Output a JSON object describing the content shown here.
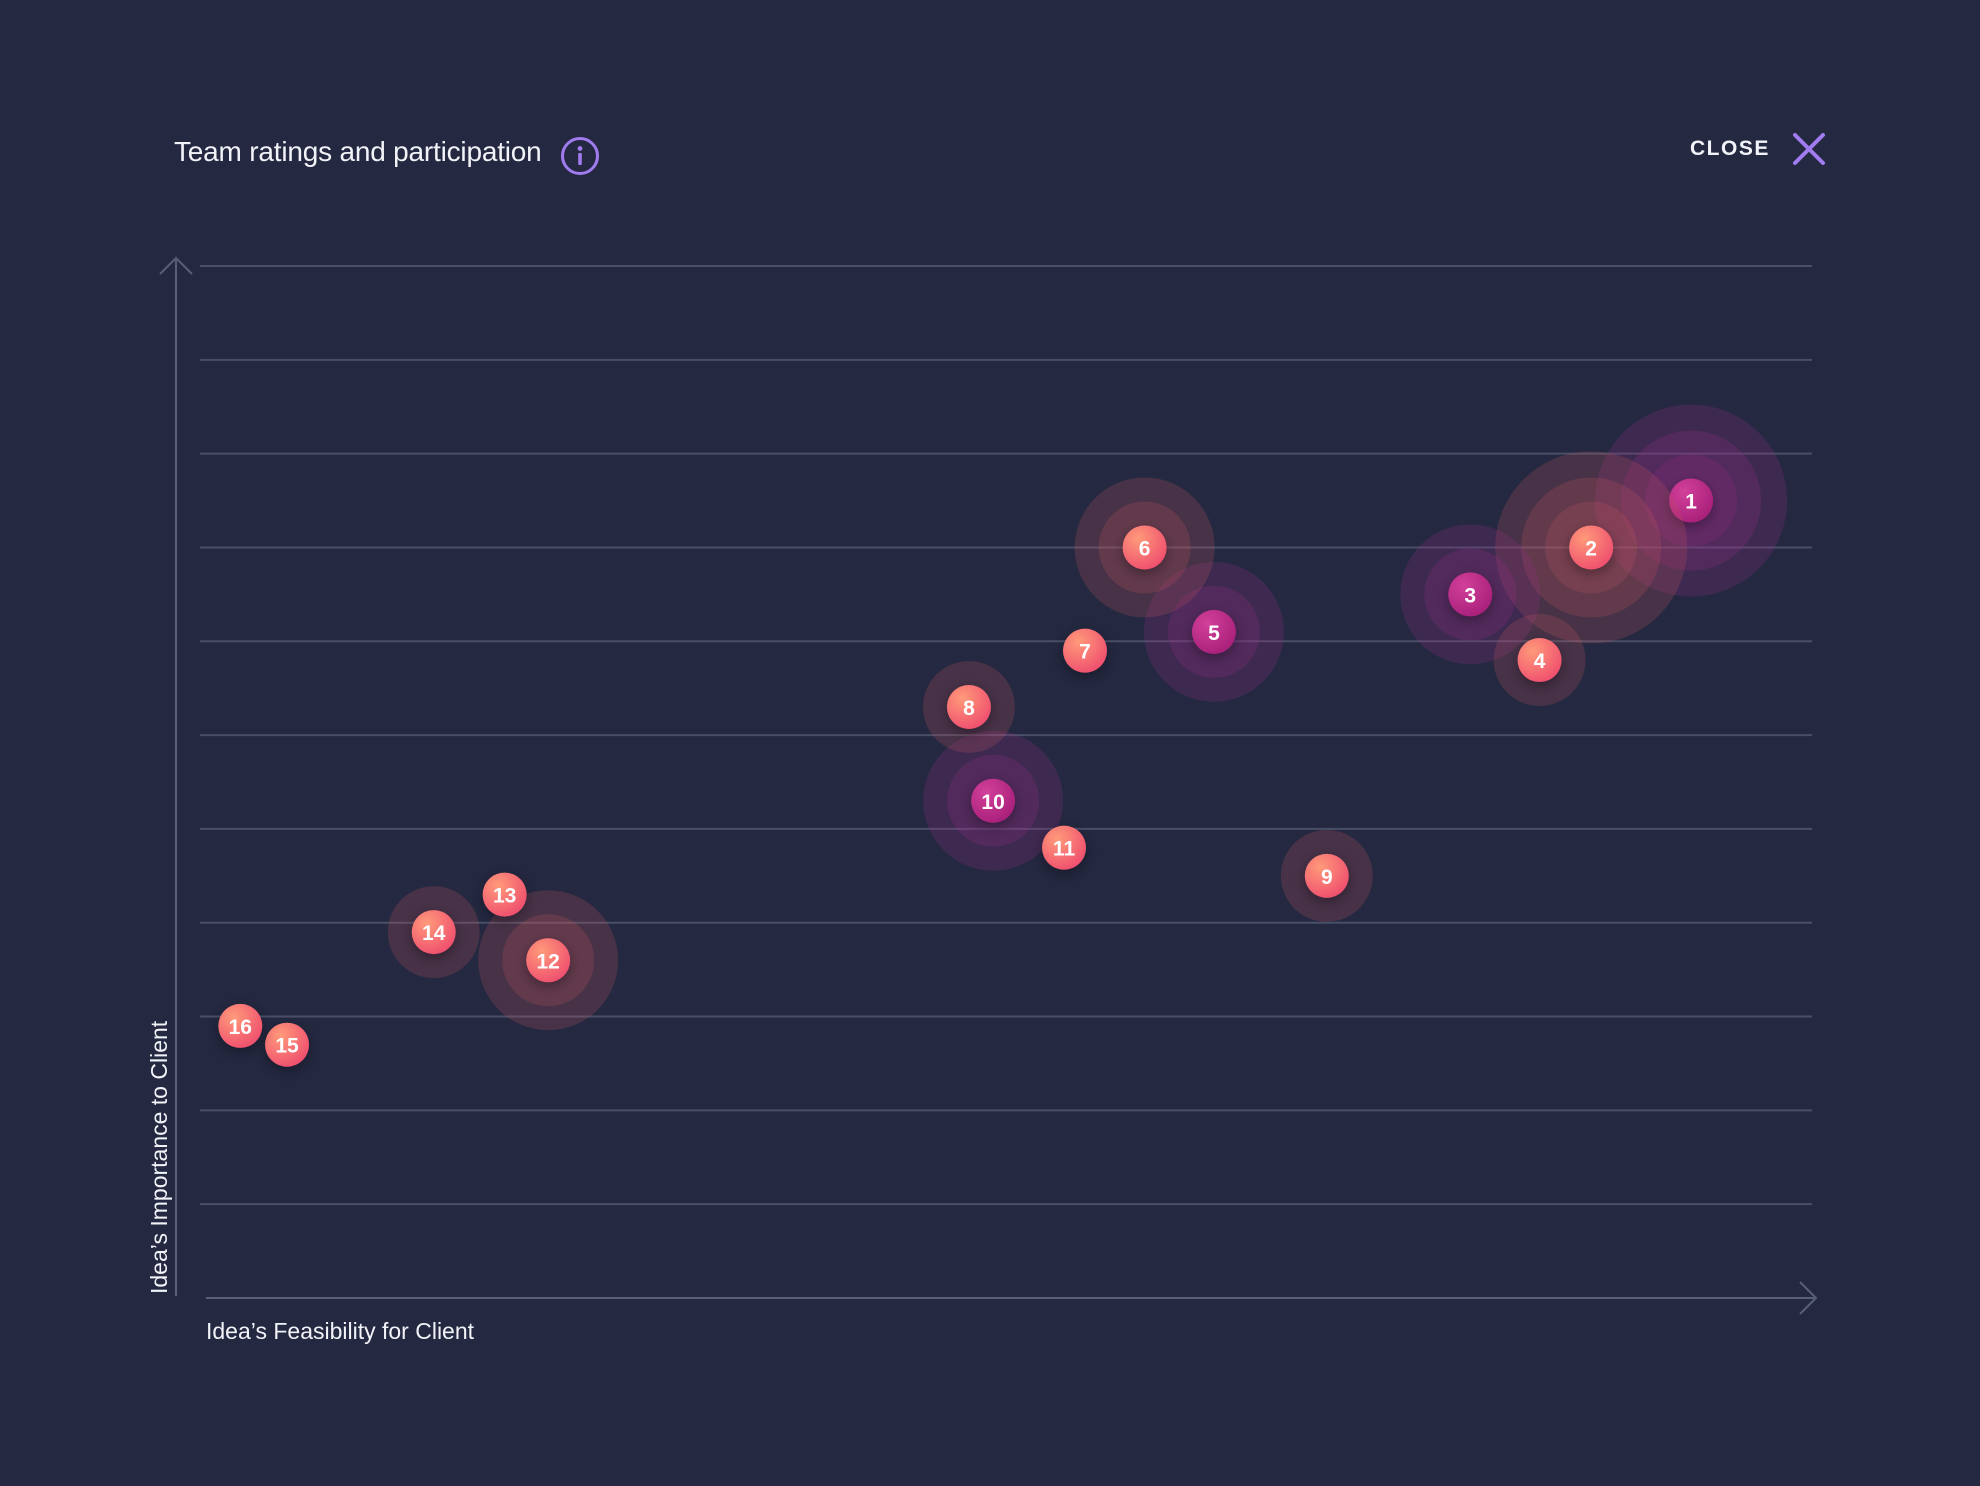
{
  "header": {
    "title": "Team ratings and participation",
    "info_icon": "info-icon",
    "close_label": "CLOSE",
    "close_icon": "close-icon"
  },
  "colors": {
    "background": "#242840",
    "accent": "#a07cf0",
    "gridline": "#4a4f68",
    "axis": "#5a5f78",
    "coral": "#f4646e",
    "magenta": "#c42a86"
  },
  "chart_data": {
    "type": "scatter",
    "title": "",
    "xlabel": "Idea’s Feasibility for Client",
    "ylabel": "Idea’s Importance to Client",
    "xlim": [
      0,
      100
    ],
    "ylim": [
      0,
      11
    ],
    "grid": "horizontal",
    "points": [
      {
        "label": "1",
        "x": 92.5,
        "y": 8.5,
        "participation": 3,
        "color": "magenta"
      },
      {
        "label": "2",
        "x": 86.3,
        "y": 8.0,
        "participation": 3,
        "color": "coral"
      },
      {
        "label": "3",
        "x": 78.8,
        "y": 7.5,
        "participation": 2,
        "color": "magenta"
      },
      {
        "label": "4",
        "x": 83.1,
        "y": 6.8,
        "participation": 1,
        "color": "coral"
      },
      {
        "label": "5",
        "x": 62.9,
        "y": 7.1,
        "participation": 2,
        "color": "magenta"
      },
      {
        "label": "6",
        "x": 58.6,
        "y": 8.0,
        "participation": 2,
        "color": "coral"
      },
      {
        "label": "7",
        "x": 54.9,
        "y": 6.9,
        "participation": 0,
        "color": "coral"
      },
      {
        "label": "8",
        "x": 47.7,
        "y": 6.3,
        "participation": 1,
        "color": "coral"
      },
      {
        "label": "9",
        "x": 69.9,
        "y": 4.5,
        "participation": 1,
        "color": "coral"
      },
      {
        "label": "10",
        "x": 49.2,
        "y": 5.3,
        "participation": 2,
        "color": "magenta"
      },
      {
        "label": "11",
        "x": 53.6,
        "y": 4.8,
        "participation": 0,
        "color": "coral"
      },
      {
        "label": "12",
        "x": 21.6,
        "y": 3.6,
        "participation": 2,
        "color": "coral"
      },
      {
        "label": "13",
        "x": 18.9,
        "y": 4.3,
        "participation": 0,
        "color": "coral"
      },
      {
        "label": "14",
        "x": 14.5,
        "y": 3.9,
        "participation": 1,
        "color": "coral"
      },
      {
        "label": "15",
        "x": 5.4,
        "y": 2.7,
        "participation": 0,
        "color": "coral"
      },
      {
        "label": "16",
        "x": 2.5,
        "y": 2.9,
        "participation": 0,
        "color": "coral"
      }
    ]
  }
}
